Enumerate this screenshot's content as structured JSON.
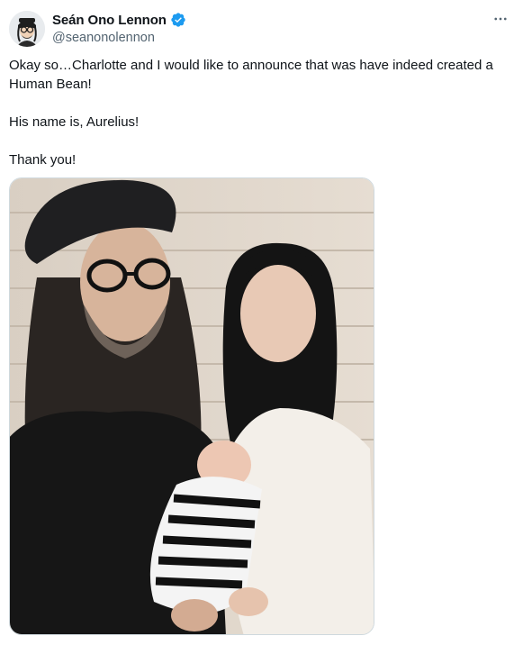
{
  "author": {
    "display_name": "Seán Ono Lennon",
    "handle": "@seanonolennon",
    "verified": true,
    "verified_color": "#1d9bf0"
  },
  "tweet": {
    "paragraphs": [
      "Okay so…Charlotte and I would like to announce that was have indeed created a Human Bean!",
      "His name is, Aurelius!",
      "Thank you!"
    ]
  },
  "icons": {
    "more": "more-horizontal-icon",
    "verified": "verified-badge-icon"
  }
}
